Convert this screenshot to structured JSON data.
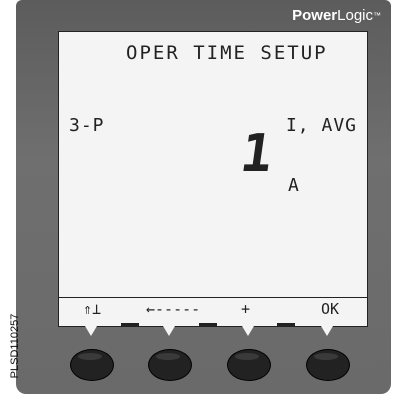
{
  "brand": {
    "bold": "Power",
    "light": "Logic"
  },
  "screen": {
    "title": "OPER TIME SETUP",
    "mode": "3-P",
    "parameter": "I, AVG",
    "value": "1",
    "unit": "A"
  },
  "softkeys": [
    {
      "label": "⇑⊥"
    },
    {
      "label": "←-----"
    },
    {
      "label": "+"
    },
    {
      "label": "OK"
    }
  ],
  "figure_id": "PLSD110257"
}
